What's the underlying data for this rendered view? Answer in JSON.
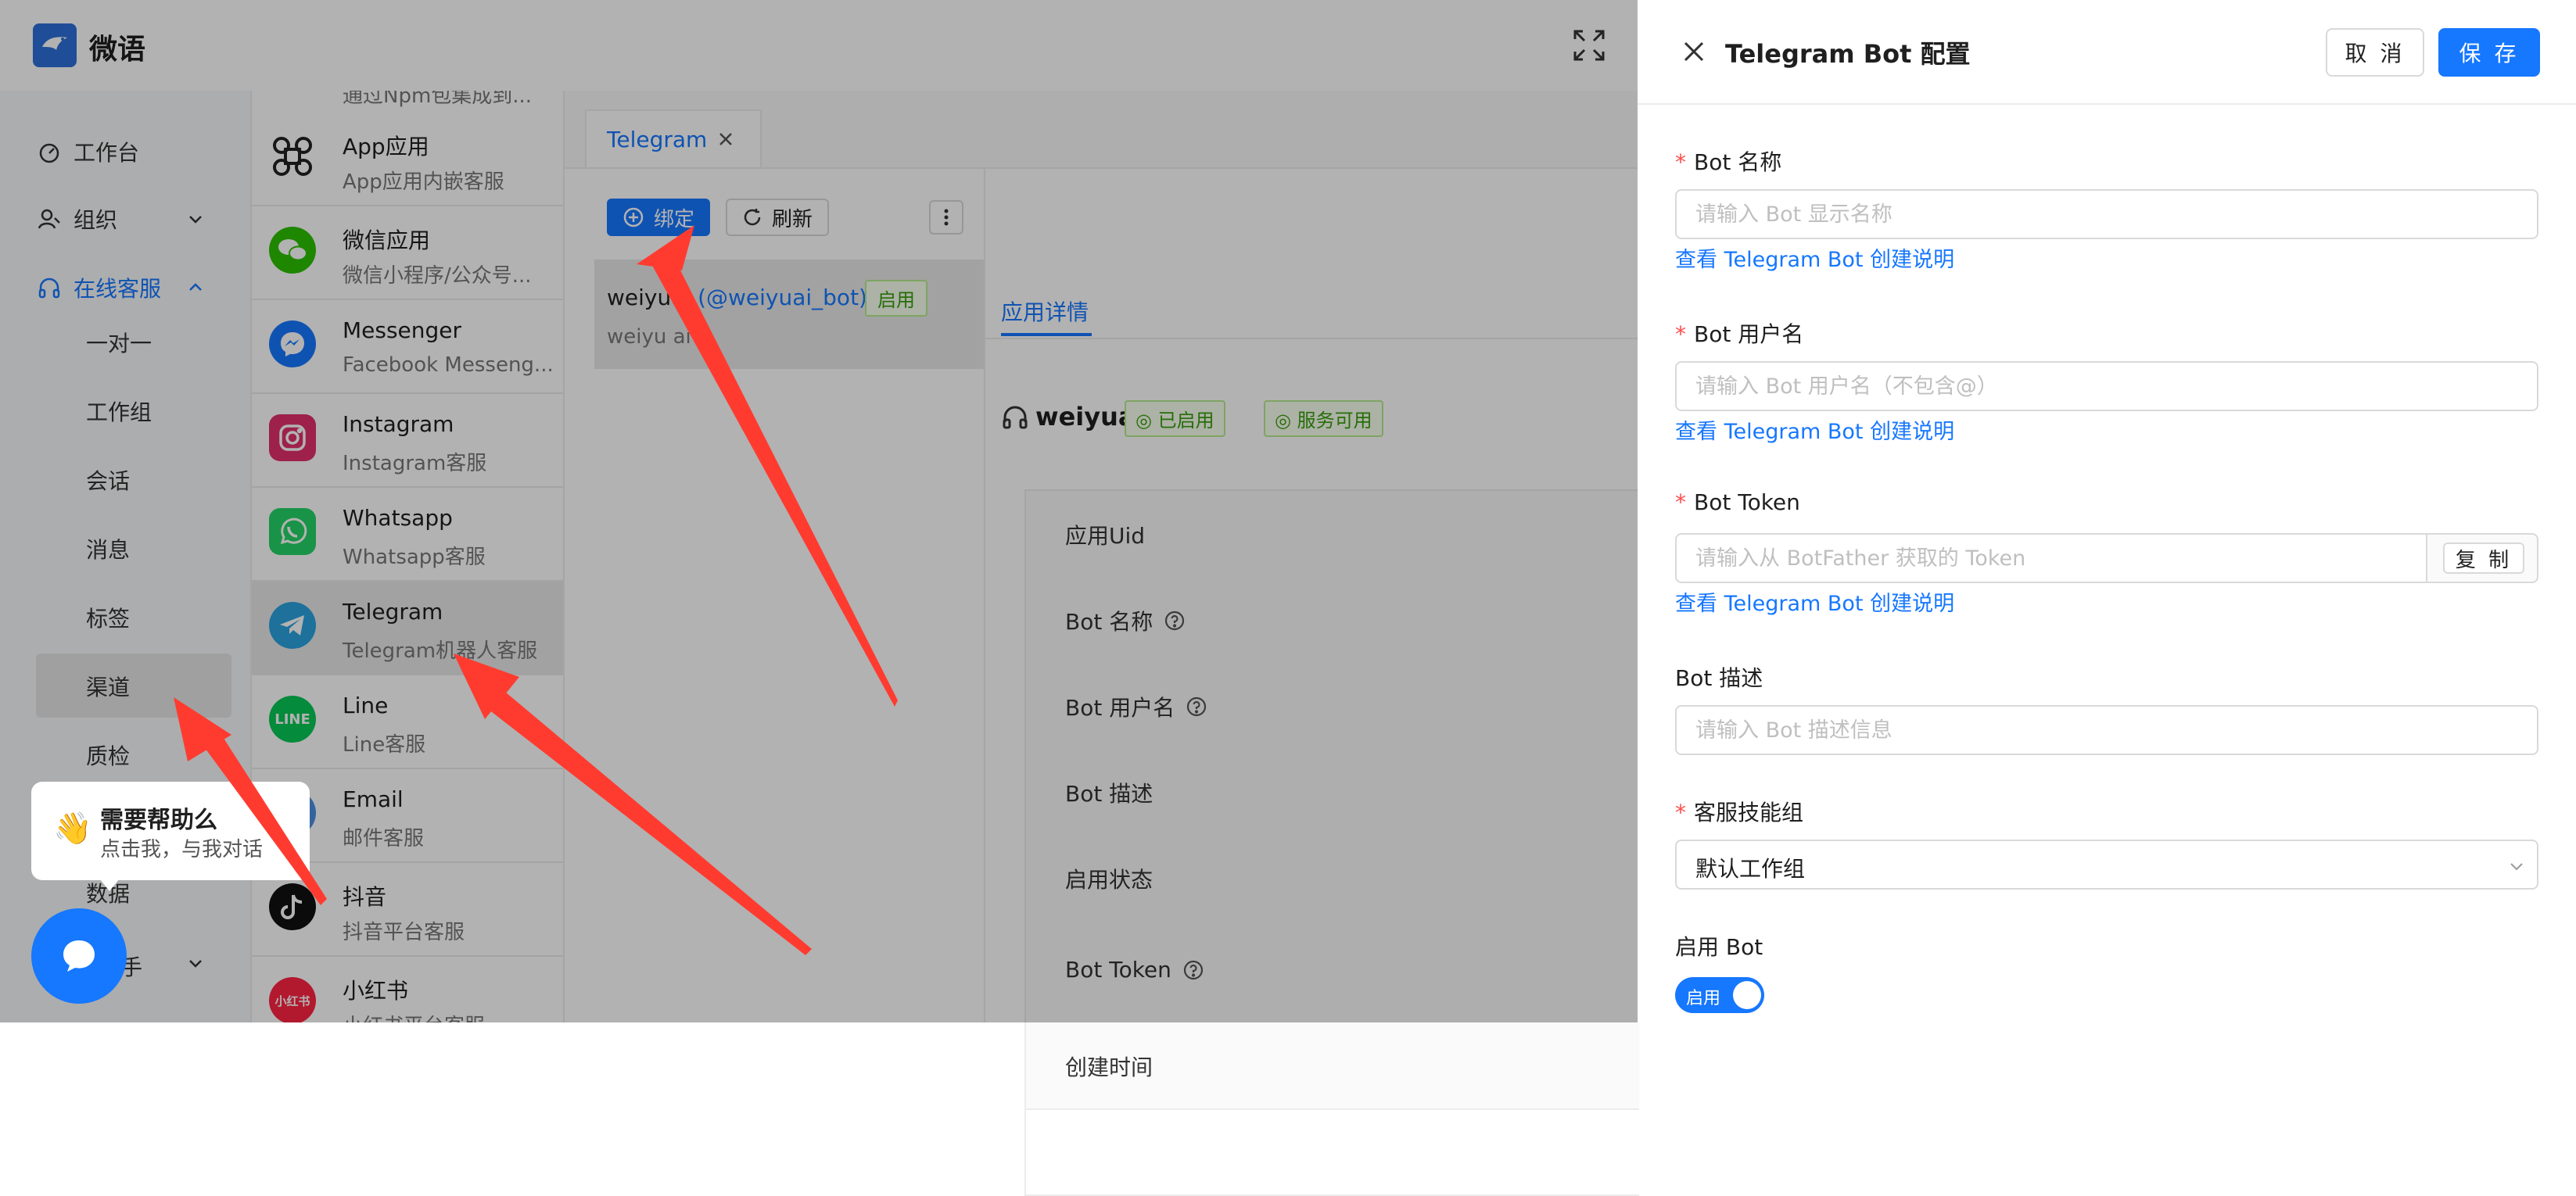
{
  "app": {
    "title": "微语"
  },
  "sidebar": {
    "items": [
      {
        "label": "工作台"
      },
      {
        "label": "组织"
      },
      {
        "label": "在线客服"
      }
    ],
    "sub_items": [
      "一对一",
      "工作组",
      "会话",
      "消息",
      "标签",
      "渠道",
      "质检",
      "数据"
    ],
    "bottom_partial": "手"
  },
  "channels": [
    {
      "name": "App应用",
      "desc": "App应用内嵌客服"
    },
    {
      "name": "微信应用",
      "desc": "微信小程序/公众号..."
    },
    {
      "name": "Messenger",
      "desc": "Facebook Messeng..."
    },
    {
      "name": "Instagram",
      "desc": "Instagram客服"
    },
    {
      "name": "Whatsapp",
      "desc": "Whatsapp客服"
    },
    {
      "name": "Telegram",
      "desc": "Telegram机器人客服"
    },
    {
      "name": "Line",
      "desc": "Line客服"
    },
    {
      "name": "Email",
      "desc": "邮件客服"
    },
    {
      "name": "抖音",
      "desc": "抖音平台客服"
    },
    {
      "name": "小红书",
      "desc": "小红书平台客服"
    }
  ],
  "channel_top_partial": "通过Npm包集成到...",
  "tab": {
    "label": "Telegram"
  },
  "list": {
    "bind_label": "绑定",
    "refresh_label": "刷新",
    "bot": {
      "name": "weiyuai",
      "username": "(@weiyuai_bot)",
      "badge": "启用",
      "desc": "weiyu ai"
    }
  },
  "detail": {
    "tab_label": "应用详情",
    "app_name": "weiyuai",
    "status_enabled": "已启用",
    "status_service": "服务可用",
    "fields": [
      "应用Uid",
      "Bot 名称",
      "Bot 用户名",
      "Bot 描述",
      "启用状态",
      "Bot Token",
      "创建时间"
    ]
  },
  "help": {
    "title": "需要帮助么",
    "subtitle": "点击我，与我对话",
    "emoji": "👋"
  },
  "drawer": {
    "title": "Telegram Bot 配置",
    "cancel_label": "取 消",
    "save_label": "保 存",
    "bot_name_label": "Bot 名称",
    "bot_name_placeholder": "请输入 Bot 显示名称",
    "help_link": "查看 Telegram Bot 创建说明",
    "bot_username_label": "Bot 用户名",
    "bot_username_placeholder": "请输入 Bot 用户名（不包含@）",
    "bot_token_label": "Bot Token",
    "bot_token_placeholder": "请输入从 BotFather 获取的 Token",
    "copy_label": "复 制",
    "bot_desc_label": "Bot 描述",
    "bot_desc_placeholder": "请输入 Bot 描述信息",
    "workgroup_label": "客服技能组",
    "workgroup_value": "默认工作组",
    "enable_label": "启用 Bot",
    "enable_switch_text": "启用",
    "required_mark": "*"
  },
  "colors": {
    "accent": "#1677ff",
    "arrow": "#ff3b30",
    "success": "#389e0d"
  }
}
